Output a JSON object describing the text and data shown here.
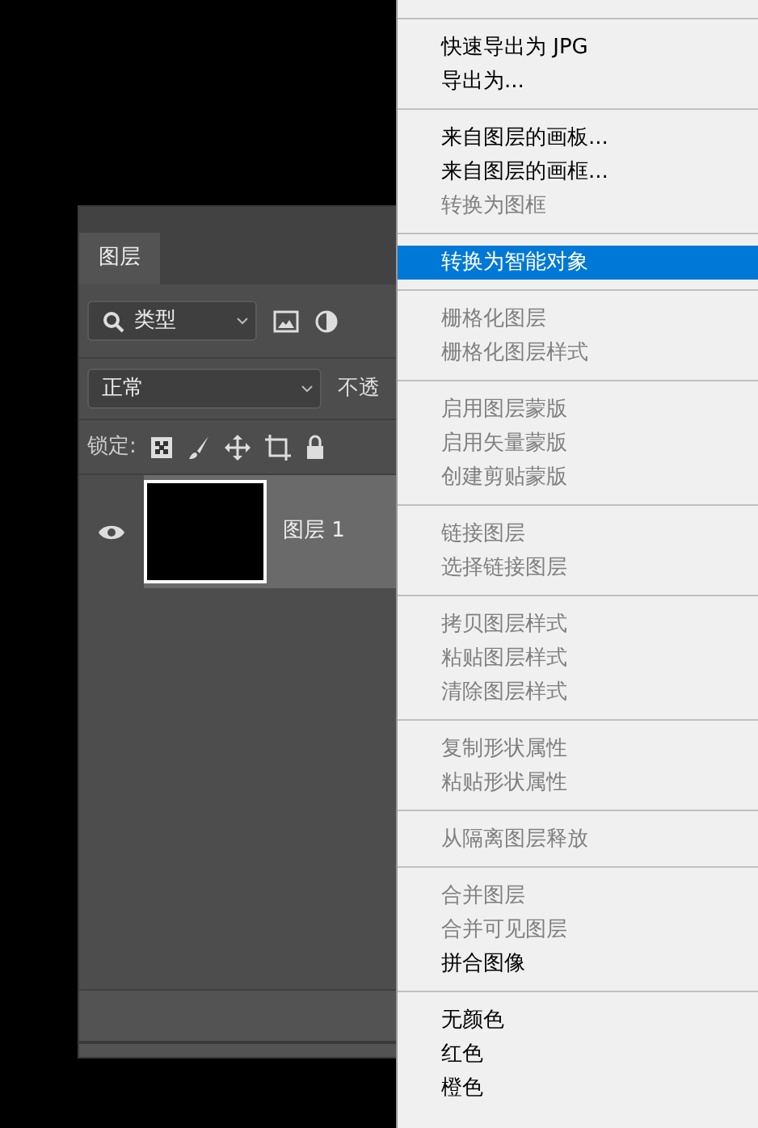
{
  "layers_panel": {
    "tab": {
      "label": "图层",
      "selected": true
    },
    "filter": {
      "value": "类型"
    },
    "blend_mode": {
      "value": "正常"
    },
    "opacity_label": "不透",
    "lock_label": "锁定:",
    "layers": [
      {
        "name": "图层 1",
        "visible": true,
        "selected": true
      }
    ]
  },
  "context_menu": {
    "groups": [
      [
        {
          "label": "快速导出为 JPG",
          "disabled": false,
          "selected": false
        },
        {
          "label": "导出为...",
          "disabled": false,
          "selected": false
        }
      ],
      [
        {
          "label": "来自图层的画板...",
          "disabled": false,
          "selected": false
        },
        {
          "label": "来自图层的画框...",
          "disabled": false,
          "selected": false
        },
        {
          "label": "转换为图框",
          "disabled": true,
          "selected": false
        }
      ],
      [
        {
          "label": "转换为智能对象",
          "disabled": false,
          "selected": true
        }
      ],
      [
        {
          "label": "栅格化图层",
          "disabled": true,
          "selected": false
        },
        {
          "label": "栅格化图层样式",
          "disabled": true,
          "selected": false
        }
      ],
      [
        {
          "label": "启用图层蒙版",
          "disabled": true,
          "selected": false
        },
        {
          "label": "启用矢量蒙版",
          "disabled": true,
          "selected": false
        },
        {
          "label": "创建剪贴蒙版",
          "disabled": true,
          "selected": false
        }
      ],
      [
        {
          "label": "链接图层",
          "disabled": true,
          "selected": false
        },
        {
          "label": "选择链接图层",
          "disabled": true,
          "selected": false
        }
      ],
      [
        {
          "label": "拷贝图层样式",
          "disabled": true,
          "selected": false
        },
        {
          "label": "粘贴图层样式",
          "disabled": true,
          "selected": false
        },
        {
          "label": "清除图层样式",
          "disabled": true,
          "selected": false
        }
      ],
      [
        {
          "label": "复制形状属性",
          "disabled": true,
          "selected": false
        },
        {
          "label": "粘贴形状属性",
          "disabled": true,
          "selected": false
        }
      ],
      [
        {
          "label": "从隔离图层释放",
          "disabled": true,
          "selected": false
        }
      ],
      [
        {
          "label": "合并图层",
          "disabled": true,
          "selected": false
        },
        {
          "label": "合并可见图层",
          "disabled": true,
          "selected": false
        },
        {
          "label": "拼合图像",
          "disabled": false,
          "selected": false
        }
      ],
      [
        {
          "label": "无颜色",
          "disabled": false,
          "selected": false
        },
        {
          "label": "红色",
          "disabled": false,
          "selected": false
        },
        {
          "label": "橙色",
          "disabled": false,
          "selected": false
        }
      ]
    ]
  }
}
